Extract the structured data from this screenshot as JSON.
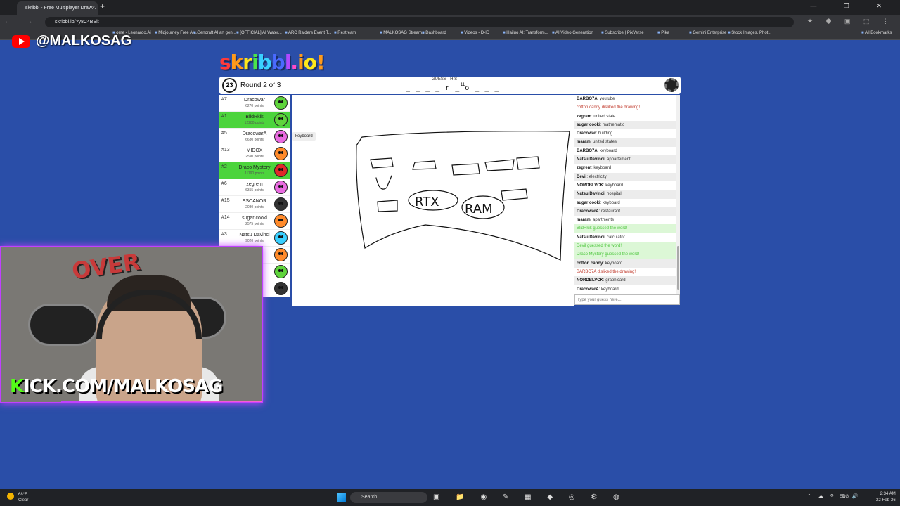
{
  "browser": {
    "tab_title": "skribbl - Free Multiplayer Draw...",
    "tab_close": "×",
    "new_tab": "+",
    "window_controls": "— ❐ ✕",
    "nav": "← → ⟳",
    "url": "skribbl.io/?y8C4BSlt",
    "extensions": "★ ⬢ ▣ ⬚ ⋮",
    "bookmarks": [
      "ome - Leonardo.Ai",
      "Midjourney Free AI...",
      "Gencraft AI art gen...",
      "[OFFICIAL] AI Water...",
      "ARC Raiders Event T...",
      "Restream",
      "MALKOSAG Stream...",
      "Dashboard",
      "Videos - D-ID",
      "Hailuo AI: Transform...",
      "AI Video Generation",
      "Subscribe | PixVerse",
      "Pika",
      "Gemini Enterprise",
      "Stock Images, Phot...",
      "All Bookmarks"
    ]
  },
  "overlay": {
    "youtube_handle": "@MALKOSAG",
    "kick_k": "K",
    "kick_rest": "ICK.COM/MALKOSAG",
    "graffiti": "OVER"
  },
  "game": {
    "logo_letters": [
      "s",
      "k",
      "r",
      "i",
      "b",
      "b",
      "l",
      ".",
      "i",
      "o"
    ],
    "logo_pencil": "!",
    "timer": "23",
    "round": "Round 2 of 3",
    "guess_label": "GUESS THIS",
    "word_pattern": "_ _ _ _ r _ o _ _ _",
    "word_count": "11",
    "tooltip": "keyboard",
    "players": [
      {
        "rank": "#7",
        "name": "Dracowar",
        "points": "6270 points",
        "color": "#5fd43c",
        "highlight": false
      },
      {
        "rank": "#1",
        "name": "BlidRkik",
        "points": "12280 points",
        "color": "#5fd43c",
        "highlight": true
      },
      {
        "rank": "#5",
        "name": "DracowarA",
        "points": "6630 points",
        "color": "#e96be0",
        "highlight": false
      },
      {
        "rank": "#13",
        "name": "MIDOX",
        "points": "2590 points",
        "color": "#ff8a2a",
        "highlight": false
      },
      {
        "rank": "#2",
        "name": "Draco Mystery",
        "points": "11190 points",
        "color": "#e02a2a",
        "highlight": true
      },
      {
        "rank": "#6",
        "name": "zegrem",
        "points": "6355 points",
        "color": "#e96be0",
        "highlight": false
      },
      {
        "rank": "#15",
        "name": "ESCANOR",
        "points": "2030 points",
        "color": "#333333",
        "highlight": false
      },
      {
        "rank": "#14",
        "name": "sugar cooki",
        "points": "2575 points",
        "color": "#ff8a2a",
        "highlight": false
      },
      {
        "rank": "#3",
        "name": "Natsu Davinci",
        "points": "9020 points",
        "color": "#3ad0ff",
        "highlight": false
      },
      {
        "rank": "",
        "name": "",
        "points": "",
        "color": "#ff8a2a",
        "highlight": false
      },
      {
        "rank": "",
        "name": "",
        "points": "",
        "color": "#5fd43c",
        "highlight": false
      },
      {
        "rank": "",
        "name": "",
        "points": "",
        "color": "#333333",
        "highlight": false
      }
    ],
    "chat": [
      {
        "user": "BARBO7A",
        "text": "youtube",
        "type": "normal"
      },
      {
        "user": "",
        "text": "cotton candy disliked the drawing!",
        "type": "red"
      },
      {
        "user": "zegrem",
        "text": "united state",
        "type": "normal"
      },
      {
        "user": "sugar cooki",
        "text": "mathematic",
        "type": "normal"
      },
      {
        "user": "Dracowar",
        "text": "building",
        "type": "normal"
      },
      {
        "user": "maram",
        "text": "united states",
        "type": "normal"
      },
      {
        "user": "BARBO7A",
        "text": "keyboard",
        "type": "normal"
      },
      {
        "user": "Natsu Davinci",
        "text": "appartement",
        "type": "normal"
      },
      {
        "user": "zegrem",
        "text": "keyboard",
        "type": "normal"
      },
      {
        "user": "Devil",
        "text": "electricity",
        "type": "normal"
      },
      {
        "user": "NORDBLVCK",
        "text": "keyboard",
        "type": "normal"
      },
      {
        "user": "Natsu Davinci",
        "text": "hospital",
        "type": "normal"
      },
      {
        "user": "sugar cooki",
        "text": "keyboard",
        "type": "normal"
      },
      {
        "user": "DracowarA",
        "text": "restaurant",
        "type": "normal"
      },
      {
        "user": "maram",
        "text": "apartments",
        "type": "normal"
      },
      {
        "user": "",
        "text": "BlidRkik guessed the word!",
        "type": "green"
      },
      {
        "user": "Natsu Davinci",
        "text": "calculator",
        "type": "normal"
      },
      {
        "user": "",
        "text": "Devil guessed the word!",
        "type": "green"
      },
      {
        "user": "",
        "text": "Draco Mystery guessed the word!",
        "type": "green"
      },
      {
        "user": "cotton candy",
        "text": "keyboard",
        "type": "normal"
      },
      {
        "user": "",
        "text": "BARBO7A disliked the drawing!",
        "type": "red"
      },
      {
        "user": "NORDBLVCK",
        "text": "graphicard",
        "type": "normal"
      },
      {
        "user": "DracowarA",
        "text": "keyboard",
        "type": "normal"
      }
    ],
    "guess_placeholder": "Type your guess here...",
    "drawing_text": [
      "RTX",
      "RAM"
    ]
  },
  "taskbar": {
    "weather_temp": "68°F",
    "weather_cond": "Clear",
    "search": "Search",
    "icons": "▣ 📁 ◉ ✎ ▦ ◆ ◎ ⚙ ◍",
    "tray": "⌃ ☁ ⚲ ⇅ 🔊",
    "lang": "ENG",
    "time": "2:34 AM",
    "date": "22-Feb-26"
  }
}
